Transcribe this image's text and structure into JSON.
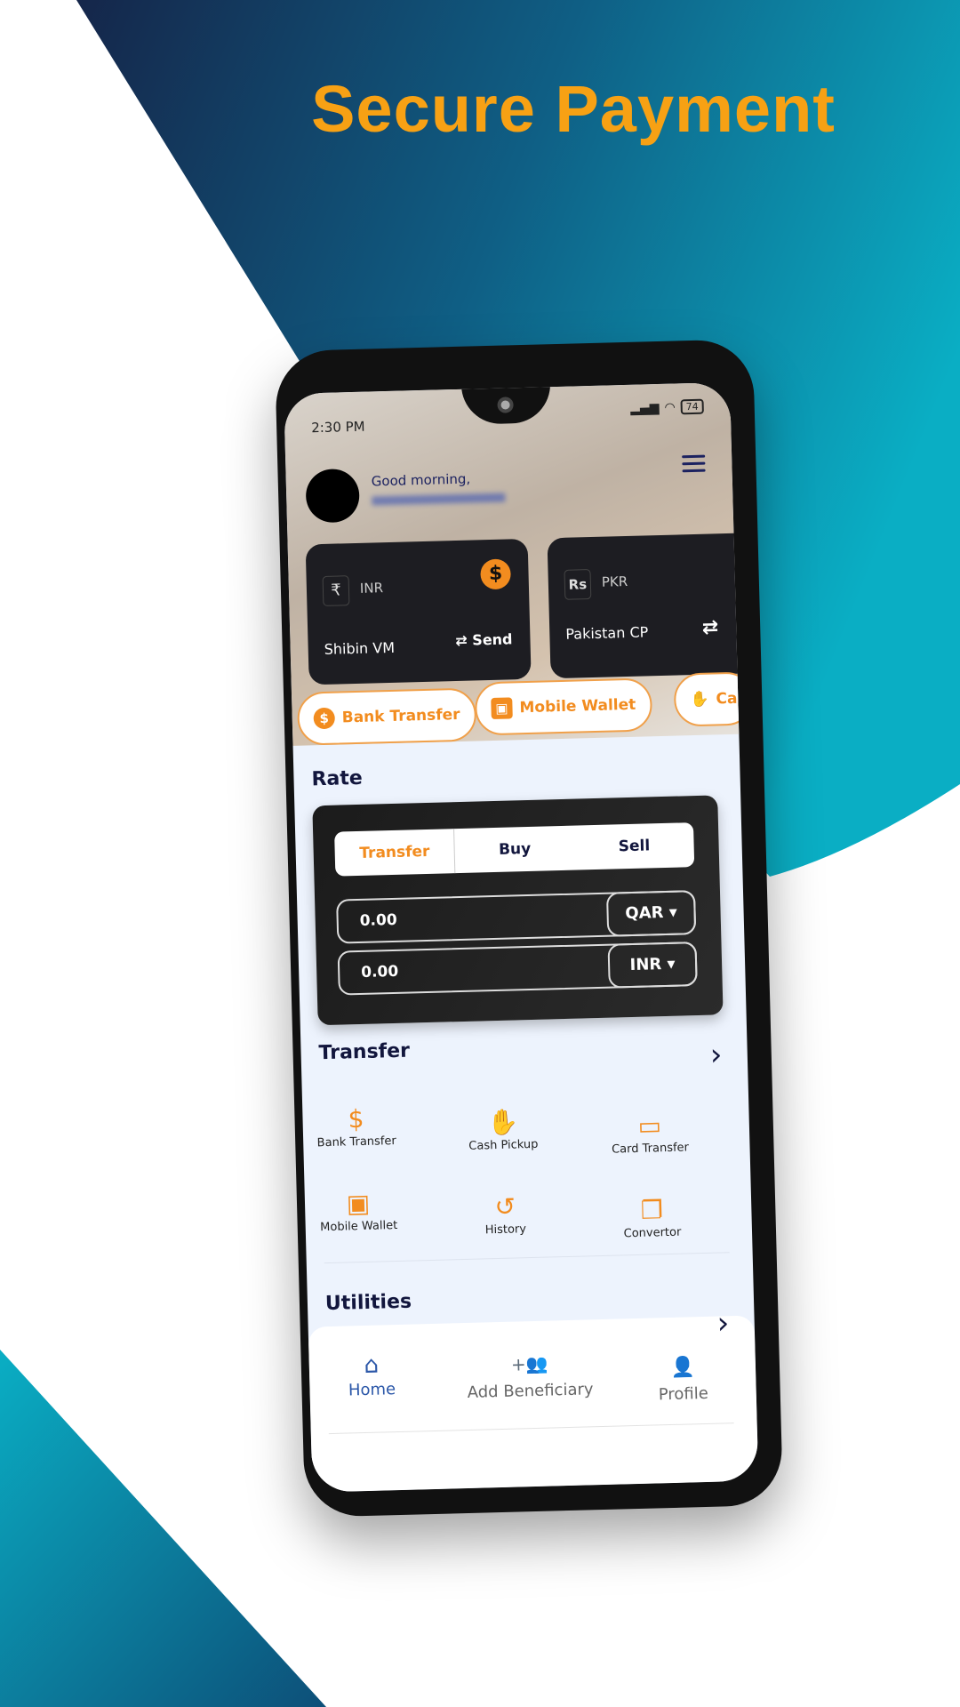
{
  "headline": "Secure Payment",
  "colors": {
    "accent": "#f28c1f",
    "headline": "#f7a114",
    "navy": "#12163d",
    "bg_dark": "#15365a",
    "bg_teal": "#0aa9bf"
  },
  "status": {
    "time": "2:30 PM",
    "battery": "74"
  },
  "header": {
    "greeting": "Good morning,"
  },
  "cards": [
    {
      "currency_icon": "₹",
      "currency": "INR",
      "name": "Shibin VM",
      "action": "Send",
      "icon": "dollar-icon"
    },
    {
      "currency_icon": "Rs",
      "currency": "PKR",
      "name": "Pakistan CP",
      "icon": "swap-icon"
    }
  ],
  "chips": [
    {
      "label": "Bank Transfer",
      "icon": "$"
    },
    {
      "label": "Mobile Wallet",
      "icon": "▣"
    },
    {
      "label": "Ca",
      "icon": "✋"
    }
  ],
  "rate": {
    "title": "Rate",
    "tabs": [
      "Transfer",
      "Buy",
      "Sell"
    ],
    "active_tab": "Transfer",
    "rows": [
      {
        "value": "0.00",
        "currency": "QAR"
      },
      {
        "value": "0.00",
        "currency": "INR"
      }
    ]
  },
  "transfer": {
    "title": "Transfer",
    "items": [
      {
        "label": "Bank Transfer",
        "icon": "$"
      },
      {
        "label": "Cash Pickup",
        "icon": "✋"
      },
      {
        "label": "Card Transfer",
        "icon": "▭"
      },
      {
        "label": "Mobile Wallet",
        "icon": "▣"
      },
      {
        "label": "History",
        "icon": "↺"
      },
      {
        "label": "Convertor",
        "icon": "❐"
      }
    ]
  },
  "utilities": {
    "title": "Utilities"
  },
  "nav": [
    {
      "label": "Home",
      "icon": "⌂"
    },
    {
      "label": "Add Beneficiary",
      "icon": "+👥"
    },
    {
      "label": "Profile",
      "icon": "👤"
    }
  ]
}
